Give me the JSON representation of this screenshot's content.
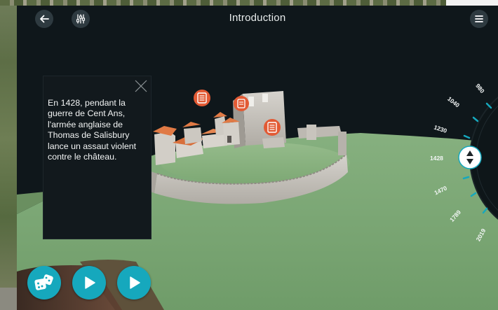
{
  "header": {
    "title": "Introduction",
    "back_icon": "arrow-left-icon",
    "settings_icon": "sliders-icon",
    "menu_icon": "hamburger-menu-icon"
  },
  "info_panel": {
    "lines": [
      "En 1428, pendant la",
      "guerre de Cent Ans,",
      "l'armée anglaise de",
      "Thomas de Salisbury",
      "lance un assaut violent",
      "contre le château."
    ],
    "close_icon": "close-icon"
  },
  "scene": {
    "markers": [
      "document-marker-icon",
      "document-marker-icon",
      "document-marker-icon"
    ]
  },
  "timeline": {
    "years": [
      "980",
      "1040",
      "1230",
      "1428",
      "1470",
      "1789",
      "2019"
    ],
    "selected": "1428",
    "handle_icon": "up-down-arrows-icon"
  },
  "actions": {
    "dice_icon": "dice-icon",
    "play_icon": "play-icon",
    "play_icon_2": "play-icon"
  },
  "colors": {
    "accent": "#16a8bd",
    "marker": "#e25a34",
    "grass": "#7aa673",
    "wall": "#c9c6c0",
    "roof": "#e07a45"
  }
}
